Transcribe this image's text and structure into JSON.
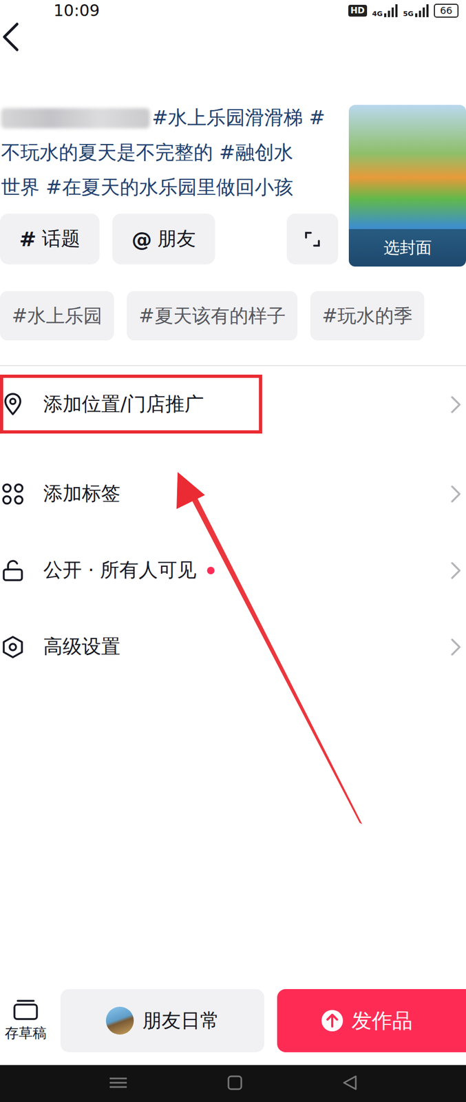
{
  "status_bar": {
    "time": "10:09",
    "hd": "HD",
    "network": [
      "4G",
      "5G"
    ],
    "battery": "66"
  },
  "caption": {
    "lines": [
      "#水上乐园滑滑梯 #",
      "不玩水的夏天是不完整的 #融创水",
      "世界 #在夏天的水乐园里做回小孩"
    ]
  },
  "cover": {
    "label": "选封面"
  },
  "tools": [
    {
      "symbol": "#",
      "label": "话题"
    },
    {
      "symbol": "@",
      "label": "朋友"
    }
  ],
  "suggested_topics": [
    "#水上乐园",
    "#夏天该有的样子",
    "#玩水的季"
  ],
  "settings": [
    {
      "label": "添加位置/门店推广",
      "kind": "location",
      "highlighted": true,
      "badge": false
    },
    {
      "label": "添加标签",
      "kind": "tags",
      "highlighted": false,
      "badge": false
    },
    {
      "label": "公开 · 所有人可见",
      "kind": "privacy",
      "highlighted": false,
      "badge": true
    },
    {
      "label": "高级设置",
      "kind": "advanced",
      "highlighted": false,
      "badge": false
    }
  ],
  "bottom_bar": {
    "draft": "存草稿",
    "daily": "朋友日常",
    "publish": "发作品"
  }
}
